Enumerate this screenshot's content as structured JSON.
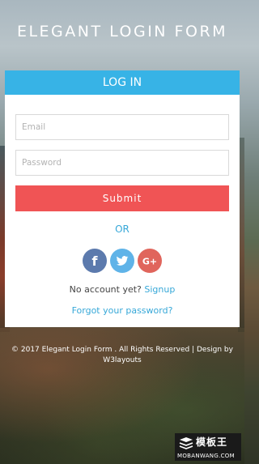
{
  "page": {
    "title": "ELEGANT LOGIN FORM"
  },
  "card": {
    "header": "LOG IN",
    "email_placeholder": "Email",
    "password_placeholder": "Password",
    "submit_label": "Submit",
    "or_label": "OR",
    "no_account_text": "No account yet?",
    "signup_label": "Signup",
    "forgot_label": "Forgot your password?"
  },
  "social": {
    "facebook_glyph": "f",
    "googleplus_glyph": "G+",
    "icons": [
      "facebook-icon",
      "twitter-icon",
      "google-plus-icon"
    ]
  },
  "footer": {
    "text": "© 2017 Elegant Login Form . All Rights Reserved | Design by",
    "link": "W3layouts"
  },
  "watermark": {
    "brand": "模板王",
    "site": "MOBANWANG.COM"
  },
  "colors": {
    "header_blue": "#37b3e6",
    "submit_red": "#f05455",
    "link_blue": "#37a8d8",
    "facebook": "#5c7aad",
    "twitter": "#5fb3e8",
    "googleplus": "#e0655c"
  }
}
